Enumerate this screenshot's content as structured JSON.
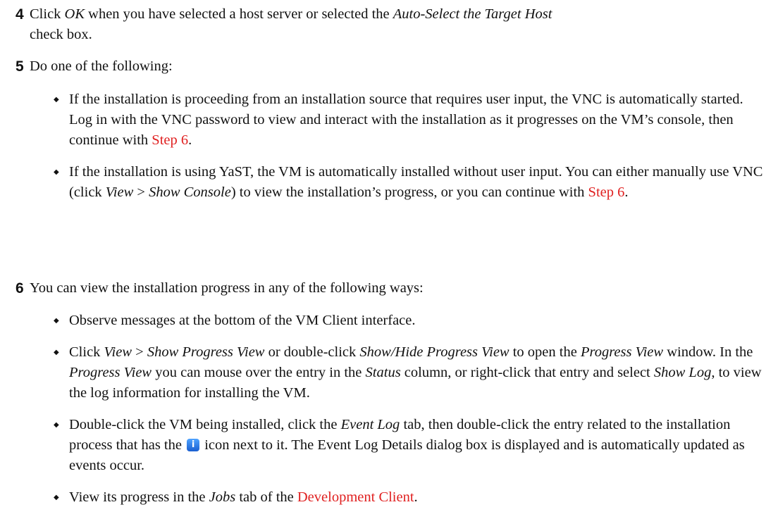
{
  "step4": {
    "number": "4",
    "t1": "Click ",
    "ok": "OK",
    "t2": " when you have selected a host server or selected the ",
    "auto": "Auto-Select the Target Host",
    "t3": "check box."
  },
  "step5": {
    "number": "5",
    "intro": "Do one of the following:",
    "b1": {
      "t1": "If the installation is proceeding from an installation source that requires user input, the VNC is automatically started. Log in with the VNC password to view and interact with the installation as it progresses on the VM’s console, then continue with ",
      "link": "Step 6",
      "t2": "."
    },
    "b2": {
      "t1": "If the installation is using YaST, the VM is automatically installed without user input. You can either manually use VNC (click ",
      "view": "View",
      "sep": " > ",
      "console": "Show Console",
      "t2": ") to view the installation’s progress, or you can continue with ",
      "link": "Step 6",
      "t3": "."
    }
  },
  "step6": {
    "number": "6",
    "intro": "You can view the installation progress in any of the following ways:",
    "b1": "Observe messages at the bottom of the VM Client interface.",
    "b2": {
      "t1": "Click ",
      "view": "View",
      "sep": " > ",
      "spv": "Show Progress View",
      "t2": " or double-click ",
      "shpv": "Show/Hide Progress View",
      "t3": " to open the ",
      "pv1": "Progress View",
      "t4": " window. In the ",
      "pv2": "Progress View",
      "t5": " you can mouse over the entry in the ",
      "status": "Status",
      "t6": " column, or right-click that entry and select ",
      "showlog": "Show Log",
      "t7": ", to view the log information for installing the VM."
    },
    "b3": {
      "t1": "Double-click the VM being installed, click the ",
      "eventlog": "Event Log",
      "t2": " tab, then double-click the entry related to the installation process that has the ",
      "icon": "info-icon",
      "t3": " icon next to it. The Event Log Details dialog box is displayed and is automatically updated as events occur."
    },
    "b4": {
      "t1": "View its progress in the ",
      "jobs": "Jobs",
      "t2": " tab of the ",
      "link": "Development Client",
      "t3": "."
    }
  }
}
